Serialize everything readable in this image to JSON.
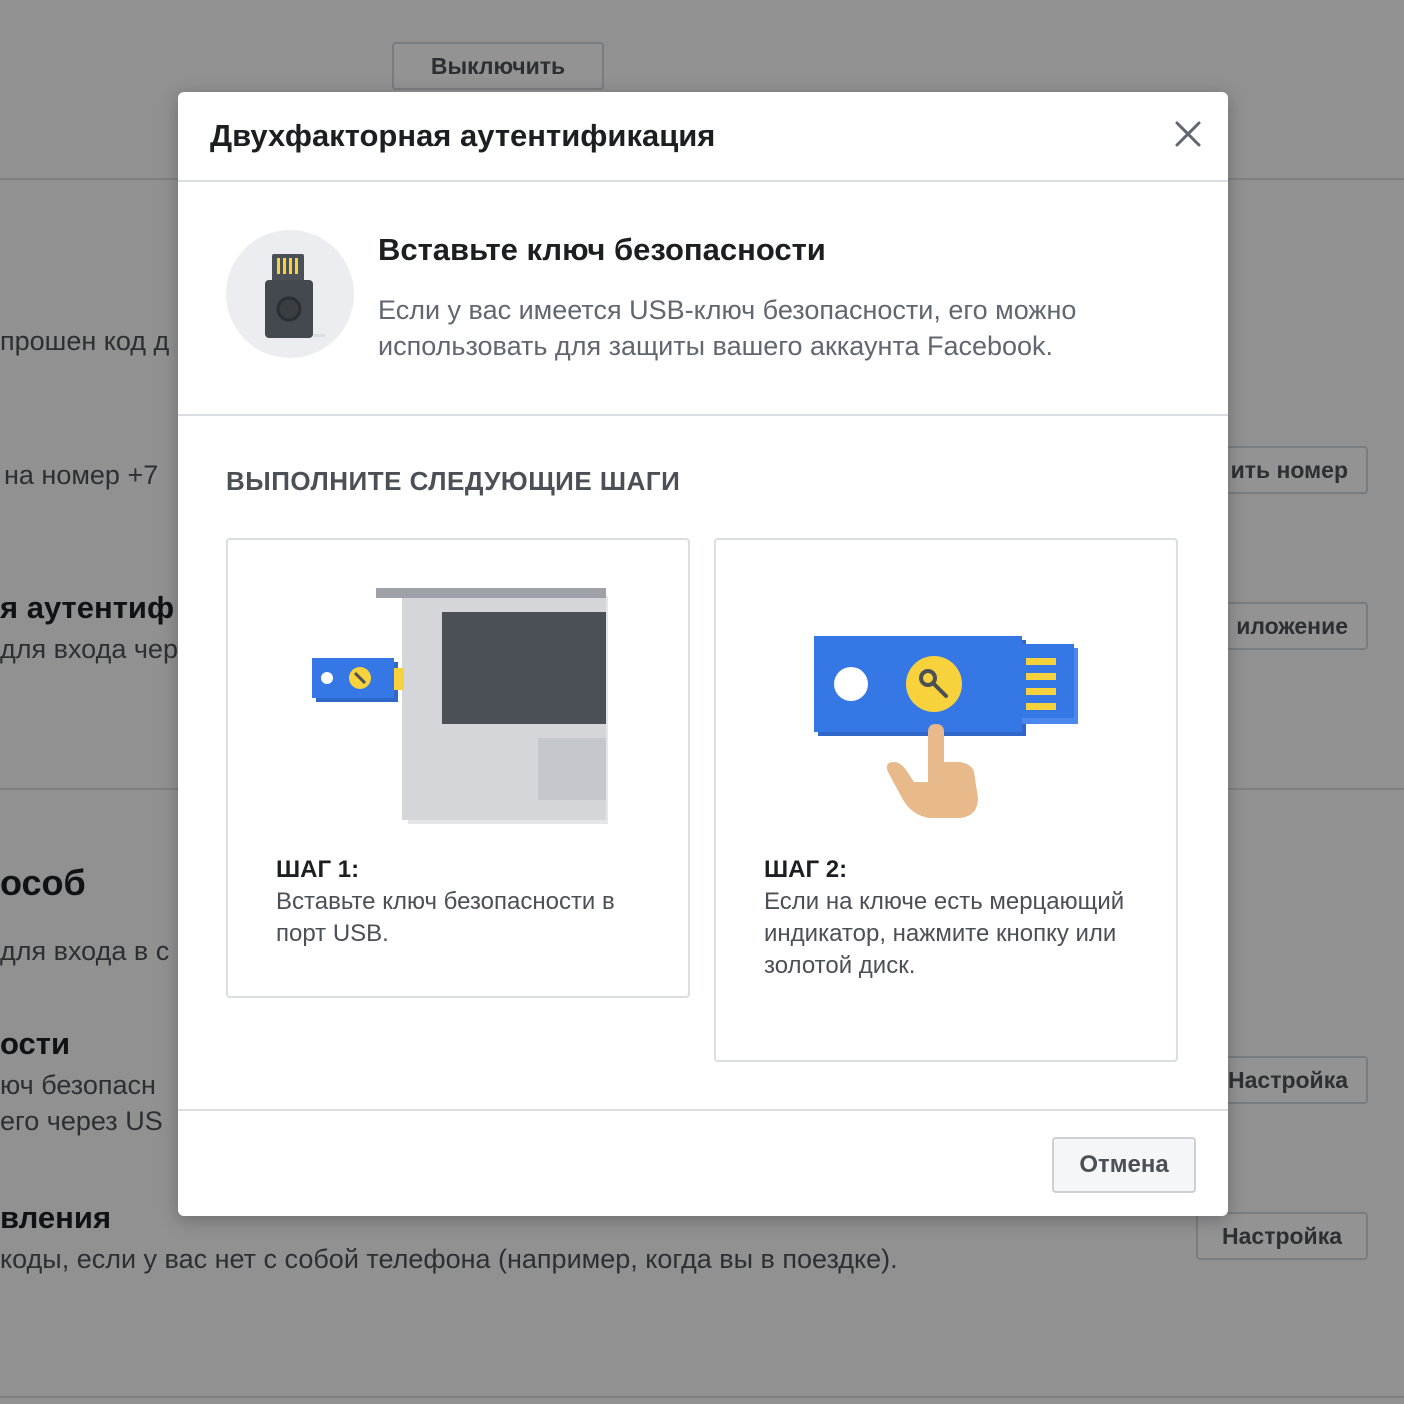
{
  "background": {
    "turn_off_button": "Выключить",
    "row1_text": "прошен код д",
    "row2_text": "на номер +7",
    "change_number_button": "ить номер",
    "row3_title": "я аутентиф",
    "row3_text": "для входа чер",
    "app_button": "иложение",
    "section_title": "особ",
    "row4_text": "для входа в с",
    "row5_title": "ости",
    "row5_line1": "юч безопасн",
    "row5_line2": "его через US",
    "setup_button_1": "Настройка",
    "row6_title": "вления",
    "row6_text": "коды, если у вас нет с собой телефона (например, когда вы в поездке).",
    "setup_button_2": "Настройка"
  },
  "dialog": {
    "title": "Двухфакторная аутентификация",
    "close_icon": "close-icon",
    "intro": {
      "icon": "usb-security-key-icon",
      "title": "Вставьте ключ безопасности",
      "description": "Если у вас имеется USB-ключ безопасности, его можно использовать для защиты вашего аккаунта Facebook."
    },
    "steps_heading": "ВЫПОЛНИТЕ СЛЕДУЮЩИЕ ШАГИ",
    "steps": [
      {
        "label": "ШАГ 1:",
        "text": "Вставьте ключ безопасности в порт USB.",
        "illustration": "laptop-usb-illustration"
      },
      {
        "label": "ШАГ 2:",
        "text": "Если на ключе есть мерцающий индикатор, нажмите кнопку или золотой диск.",
        "illustration": "press-key-illustration"
      }
    ],
    "cancel_button": "Отмена"
  },
  "colors": {
    "key_blue": "#3578e5",
    "key_gold": "#f7d23d",
    "laptop_gray": "#d4d6d9",
    "screen_dark": "#4b4f56",
    "hand_skin": "#e8b98b"
  }
}
